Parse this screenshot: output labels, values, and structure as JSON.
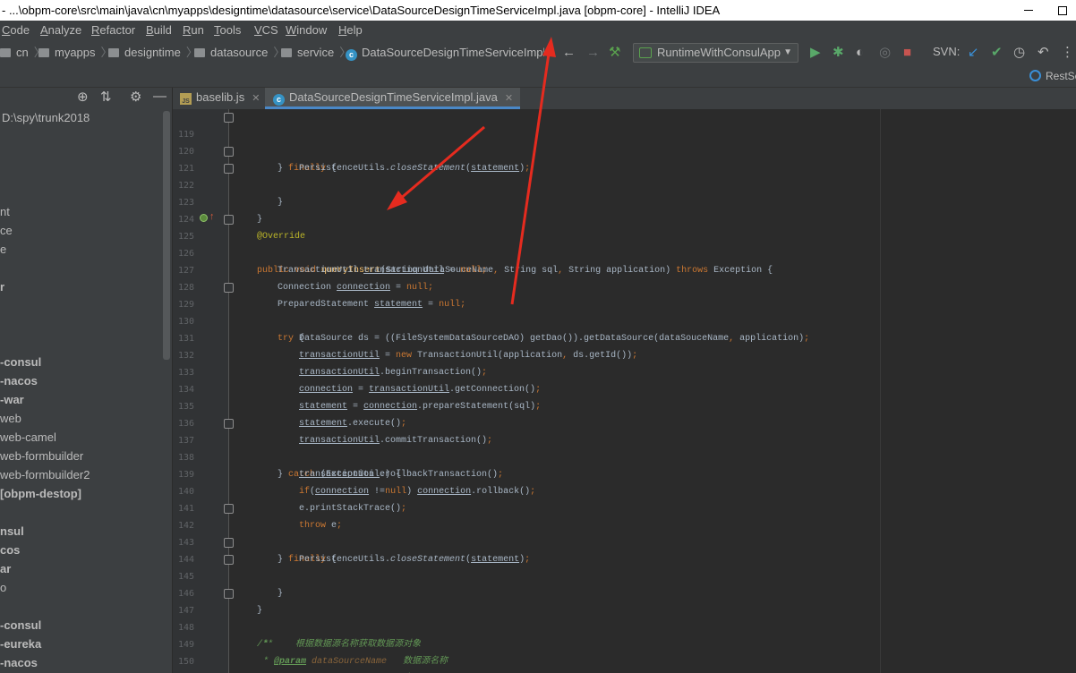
{
  "window": {
    "title": "- ...\\obpm-core\\src\\main\\java\\cn\\myapps\\designtime\\datasource\\service\\DataSourceDesignTimeServiceImpl.java [obpm-core] - IntelliJ IDEA"
  },
  "menu": [
    "Code",
    "Analyze",
    "Refactor",
    "Build",
    "Run",
    "Tools",
    "VCS",
    "Window",
    "Help"
  ],
  "breadcrumb": [
    "cn",
    "myapps",
    "designtime",
    "datasource",
    "service",
    "DataSourceDesignTimeServiceImpl"
  ],
  "toolbar": {
    "run_config": "RuntimeWithConsulApp",
    "svn_label": "SVN:",
    "rest_label": "RestSe"
  },
  "project": {
    "root_path": "D:\\spy\\trunk2018",
    "items": [
      "nt",
      "ce",
      "e",
      "r",
      "-consul",
      "-nacos",
      "-war",
      "web",
      "web-camel",
      "web-formbuilder",
      "web-formbuilder2",
      "[obpm-destop]",
      "nsul",
      "cos",
      "ar",
      "o",
      "-consul",
      "-eureka",
      "-nacos"
    ]
  },
  "tabs": [
    {
      "label": "baselib.js",
      "active": false
    },
    {
      "label": "DataSourceDesignTimeServiceImpl.java",
      "active": true
    }
  ],
  "editor": {
    "line_numbers": [
      "119",
      "120",
      "121",
      "122",
      "123",
      "124",
      "125",
      "126",
      "127",
      "128",
      "129",
      "130",
      "131",
      "132",
      "133",
      "134",
      "135",
      "136",
      "137",
      "138",
      "139",
      "140",
      "141",
      "142",
      "143",
      "144",
      "145",
      "146",
      "147",
      "148",
      "149",
      "150",
      "151"
    ]
  },
  "colors": {
    "keyword": "#cc7832",
    "annotation": "#bbb529",
    "method": "#ffc66d",
    "field": "#9876aa",
    "doc": "#629755",
    "arrow": "#e52b1f"
  }
}
